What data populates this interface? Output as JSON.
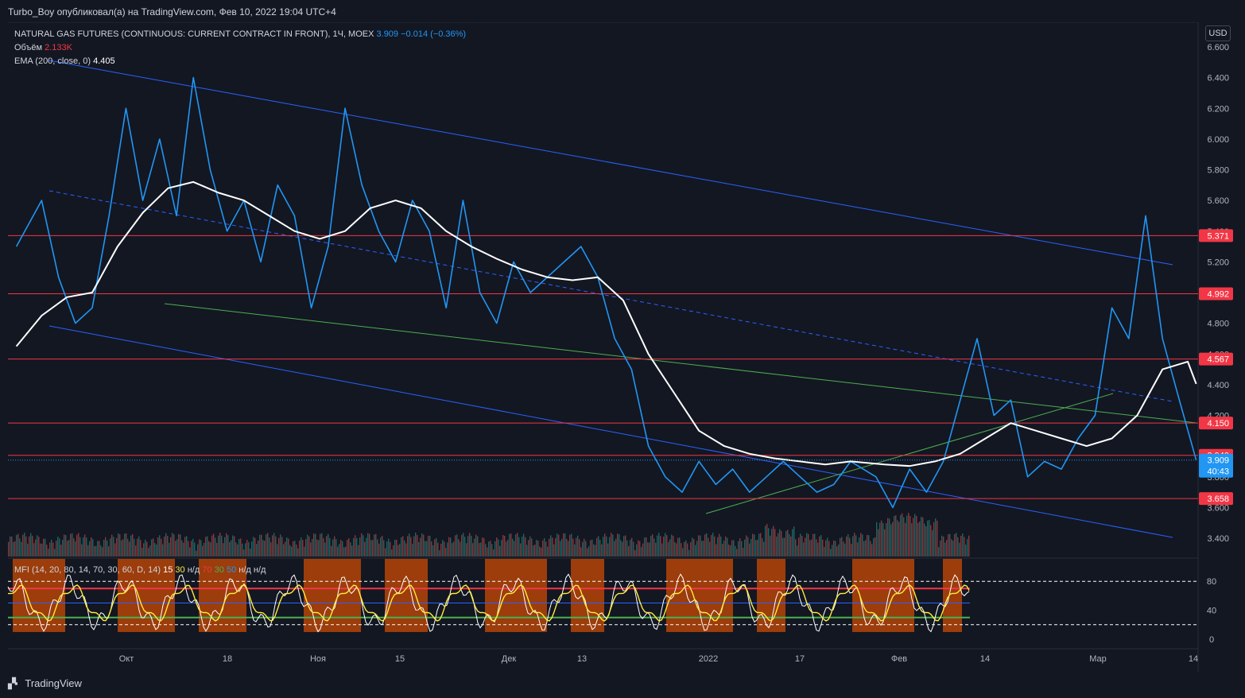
{
  "header": {
    "publisher_line": "Turbo_Boy опубликовал(а) на TradingView.com, Фев 10, 2022 19:04 UTC+4"
  },
  "legend": {
    "symbol": "NATURAL GAS FUTURES (CONTINUOUS: CURRENT CONTRACT IN FRONT), 1Ч, MOEX",
    "price": "3.909",
    "change": "−0.014 (−0.36%)",
    "volume_label": "Объём",
    "volume_value": "2.133K",
    "ema_label": "EMA (200, close, 0)",
    "ema_value": "4.405"
  },
  "currency": "USD",
  "mfi_legend": {
    "label": "MFI (14, 20, 80, 14, 70, 30, 60, D, 14)",
    "v1": "15",
    "v2": "30",
    "v3": "н/д",
    "v4": "70",
    "v5": "30",
    "v6": "50",
    "v7": "н/д",
    "v8": "н/д"
  },
  "footer": {
    "brand": "TradingView"
  },
  "colors": {
    "background": "#131722",
    "price_line": "#2196f3",
    "ema_line": "#ffffff",
    "level_line": "#f23645",
    "channel_line": "#2962ff",
    "trend_line": "#4caf50"
  },
  "chart_data": {
    "type": "line",
    "series": [
      {
        "name": "NATURAL GAS FUTURES",
        "x": [
          "2021-09-23",
          "2021-09-26",
          "2021-09-28",
          "2021-09-30",
          "2021-10-02",
          "2021-10-04",
          "2021-10-06",
          "2021-10-08",
          "2021-10-10",
          "2021-10-12",
          "2021-10-14",
          "2021-10-16",
          "2021-10-18",
          "2021-10-20",
          "2021-10-22",
          "2021-10-24",
          "2021-10-26",
          "2021-10-28",
          "2021-10-30",
          "2021-11-01",
          "2021-11-03",
          "2021-11-05",
          "2021-11-07",
          "2021-11-09",
          "2021-11-11",
          "2021-11-13",
          "2021-11-15",
          "2021-11-17",
          "2021-11-19",
          "2021-11-21",
          "2021-11-23",
          "2021-11-25",
          "2021-11-27",
          "2021-11-29",
          "2021-12-01",
          "2021-12-03",
          "2021-12-05",
          "2021-12-07",
          "2021-12-09",
          "2021-12-11",
          "2021-12-13",
          "2021-12-15",
          "2021-12-17",
          "2021-12-19",
          "2021-12-21",
          "2021-12-23",
          "2021-12-25",
          "2021-12-27",
          "2021-12-29",
          "2021-12-31",
          "2022-01-03",
          "2022-01-05",
          "2022-01-07",
          "2022-01-09",
          "2022-01-11",
          "2022-01-13",
          "2022-01-15",
          "2022-01-17",
          "2022-01-19",
          "2022-01-21",
          "2022-01-23",
          "2022-01-25",
          "2022-01-27",
          "2022-01-29",
          "2022-01-31",
          "2022-02-02",
          "2022-02-04",
          "2022-02-06",
          "2022-02-08",
          "2022-02-10"
        ],
        "values": [
          5.3,
          5.6,
          5.1,
          4.8,
          4.9,
          5.5,
          6.2,
          5.6,
          6.0,
          5.5,
          6.4,
          5.8,
          5.4,
          5.6,
          5.2,
          5.7,
          5.5,
          4.9,
          5.3,
          6.2,
          5.7,
          5.4,
          5.2,
          5.6,
          5.4,
          4.9,
          5.6,
          5.0,
          4.8,
          5.2,
          5.0,
          5.1,
          5.2,
          5.3,
          5.1,
          4.7,
          4.5,
          4.0,
          3.8,
          3.7,
          3.9,
          3.75,
          3.85,
          3.7,
          3.8,
          3.9,
          3.8,
          3.7,
          3.75,
          3.9,
          3.8,
          3.6,
          3.85,
          3.7,
          3.9,
          4.3,
          4.7,
          4.2,
          4.3,
          3.8,
          3.9,
          3.85,
          4.05,
          4.2,
          4.9,
          4.7,
          5.5,
          4.7,
          4.3,
          3.909
        ],
        "color": "#2196f3"
      },
      {
        "name": "EMA (200, close, 0)",
        "x": [
          "2021-09-23",
          "2021-09-26",
          "2021-09-29",
          "2021-10-02",
          "2021-10-05",
          "2021-10-08",
          "2021-10-11",
          "2021-10-14",
          "2021-10-17",
          "2021-10-20",
          "2021-10-23",
          "2021-10-26",
          "2021-10-29",
          "2021-11-01",
          "2021-11-04",
          "2021-11-07",
          "2021-11-10",
          "2021-11-13",
          "2021-11-16",
          "2021-11-19",
          "2021-11-22",
          "2021-11-25",
          "2021-11-28",
          "2021-12-01",
          "2021-12-04",
          "2021-12-07",
          "2021-12-10",
          "2021-12-13",
          "2021-12-16",
          "2021-12-19",
          "2021-12-22",
          "2021-12-25",
          "2021-12-28",
          "2021-12-31",
          "2022-01-04",
          "2022-01-07",
          "2022-01-10",
          "2022-01-13",
          "2022-01-16",
          "2022-01-19",
          "2022-01-22",
          "2022-01-25",
          "2022-01-28",
          "2022-01-31",
          "2022-02-03",
          "2022-02-06",
          "2022-02-09",
          "2022-02-10"
        ],
        "values": [
          4.65,
          4.85,
          4.97,
          5.0,
          5.3,
          5.52,
          5.68,
          5.72,
          5.65,
          5.6,
          5.5,
          5.4,
          5.35,
          5.4,
          5.55,
          5.6,
          5.55,
          5.4,
          5.3,
          5.22,
          5.15,
          5.1,
          5.08,
          5.1,
          4.95,
          4.6,
          4.35,
          4.1,
          4.0,
          3.95,
          3.92,
          3.9,
          3.88,
          3.9,
          3.88,
          3.87,
          3.9,
          3.95,
          4.05,
          4.15,
          4.1,
          4.05,
          4.0,
          4.05,
          4.2,
          4.5,
          4.55,
          4.405
        ],
        "color": "#ffffff"
      }
    ],
    "horizontal_levels": [
      5.371,
      4.992,
      4.567,
      4.15,
      3.94,
      3.658
    ],
    "y_tick_labels": [
      "6.600",
      "6.400",
      "6.200",
      "6.000",
      "5.800",
      "5.600",
      "5.400",
      "5.200",
      "4.800",
      "4.600",
      "4.400",
      "4.200",
      "3.800",
      "3.600",
      "3.400"
    ],
    "x_tick_labels": [
      "Окт",
      "18",
      "Ноя",
      "15",
      "Дек",
      "13",
      "2022",
      "17",
      "Фев",
      "14",
      "Мар",
      "14"
    ],
    "last_price_label": "3.909",
    "countdown_label": "40:43",
    "ylim": [
      3.3,
      6.7
    ],
    "mfi_axis_labels": [
      "80",
      "40",
      "0"
    ]
  }
}
